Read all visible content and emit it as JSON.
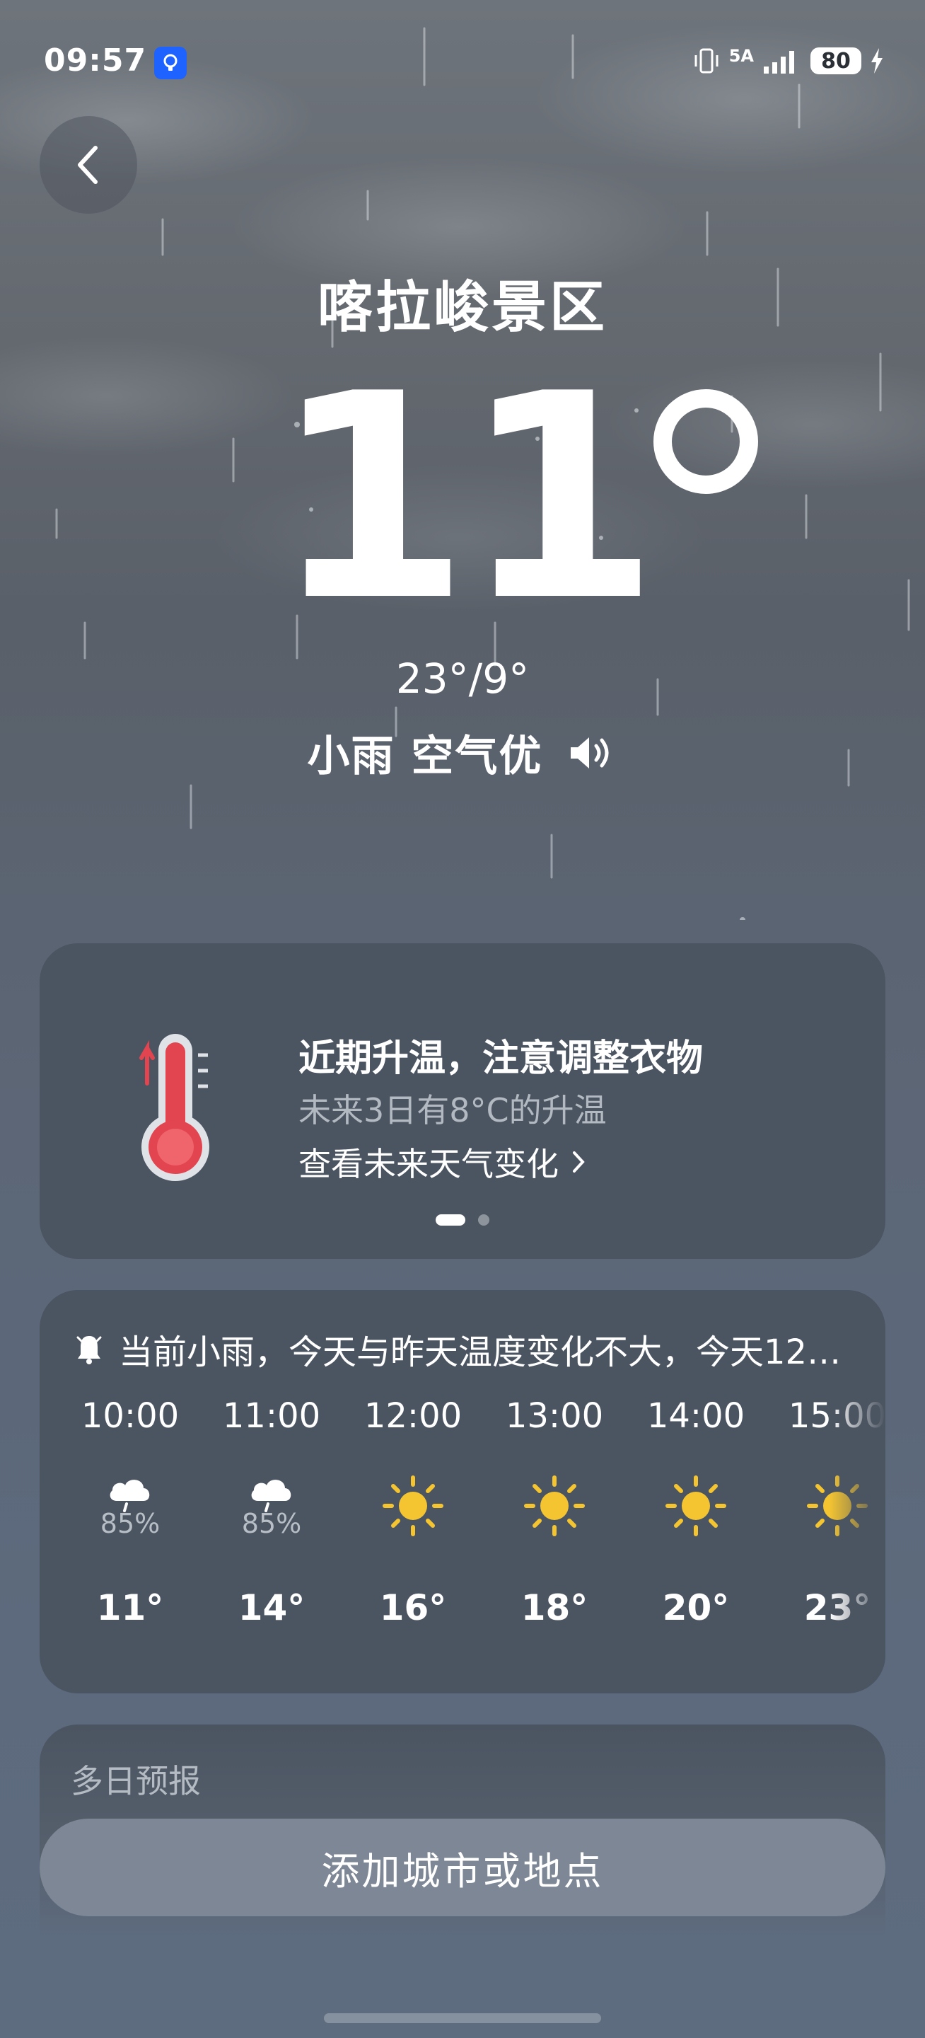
{
  "status_bar": {
    "time": "09:57",
    "network": "5A",
    "battery": "80"
  },
  "header": {
    "city": "喀拉峻景区"
  },
  "current": {
    "temperature": "11",
    "range": "23°/9°",
    "condition": "小雨 空气优"
  },
  "tip_card": {
    "title": "近期升温，注意调整衣物",
    "subtitle": "未来3日有8°C的升温",
    "link": "查看未来天气变化"
  },
  "hourly": {
    "summary": "当前小雨，今天与昨天温度变化不大，今天12…",
    "items": [
      {
        "time": "10:00",
        "icon": "rain-cloud-icon",
        "pop": "85%",
        "temp": "11°"
      },
      {
        "time": "11:00",
        "icon": "rain-cloud-icon",
        "pop": "85%",
        "temp": "14°"
      },
      {
        "time": "12:00",
        "icon": "sun-icon",
        "pop": "",
        "temp": "16°"
      },
      {
        "time": "13:00",
        "icon": "sun-icon",
        "pop": "",
        "temp": "18°"
      },
      {
        "time": "14:00",
        "icon": "sun-icon",
        "pop": "",
        "temp": "20°"
      },
      {
        "time": "15:00",
        "icon": "sun-icon",
        "pop": "",
        "temp": "23°"
      }
    ]
  },
  "forecast": {
    "title": "多日预报"
  },
  "add_button": {
    "label": "添加城市或地点"
  },
  "colors": {
    "card": "#4b5461",
    "sun": "#f5c531",
    "button": "#7d8795",
    "thermometer": "#e2454f"
  }
}
